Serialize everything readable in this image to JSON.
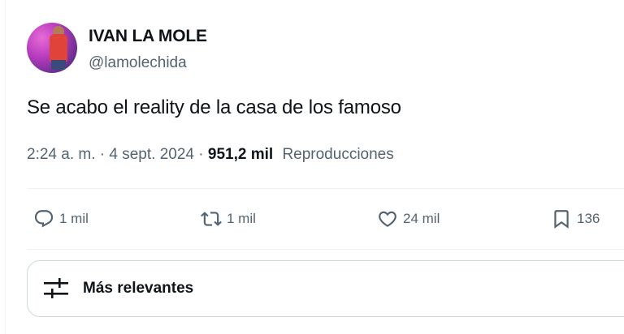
{
  "author": {
    "display_name": "IVAN LA MOLE",
    "handle": "@lamolechida",
    "avatar_icon": "profile-photo"
  },
  "tweet": {
    "text": "Se acabo el reality de la casa de los famoso"
  },
  "meta": {
    "time": "2:24 a. m.",
    "separator": "·",
    "date": "4 sept. 2024",
    "views_count": "951,2 mil",
    "views_label": "Reproducciones"
  },
  "actions": {
    "replies": {
      "icon": "reply-icon",
      "count": "1 mil"
    },
    "retweets": {
      "icon": "retweet-icon",
      "count": "1 mil"
    },
    "likes": {
      "icon": "heart-icon",
      "count": "24 mil"
    },
    "bookmarks": {
      "icon": "bookmark-icon",
      "count": "136"
    }
  },
  "sort": {
    "icon": "sliders-icon",
    "label": "Más relevantes"
  },
  "colors": {
    "text_primary": "#0f1419",
    "text_secondary": "#536471",
    "border": "#cfd9de",
    "divider": "#eff3f4"
  }
}
